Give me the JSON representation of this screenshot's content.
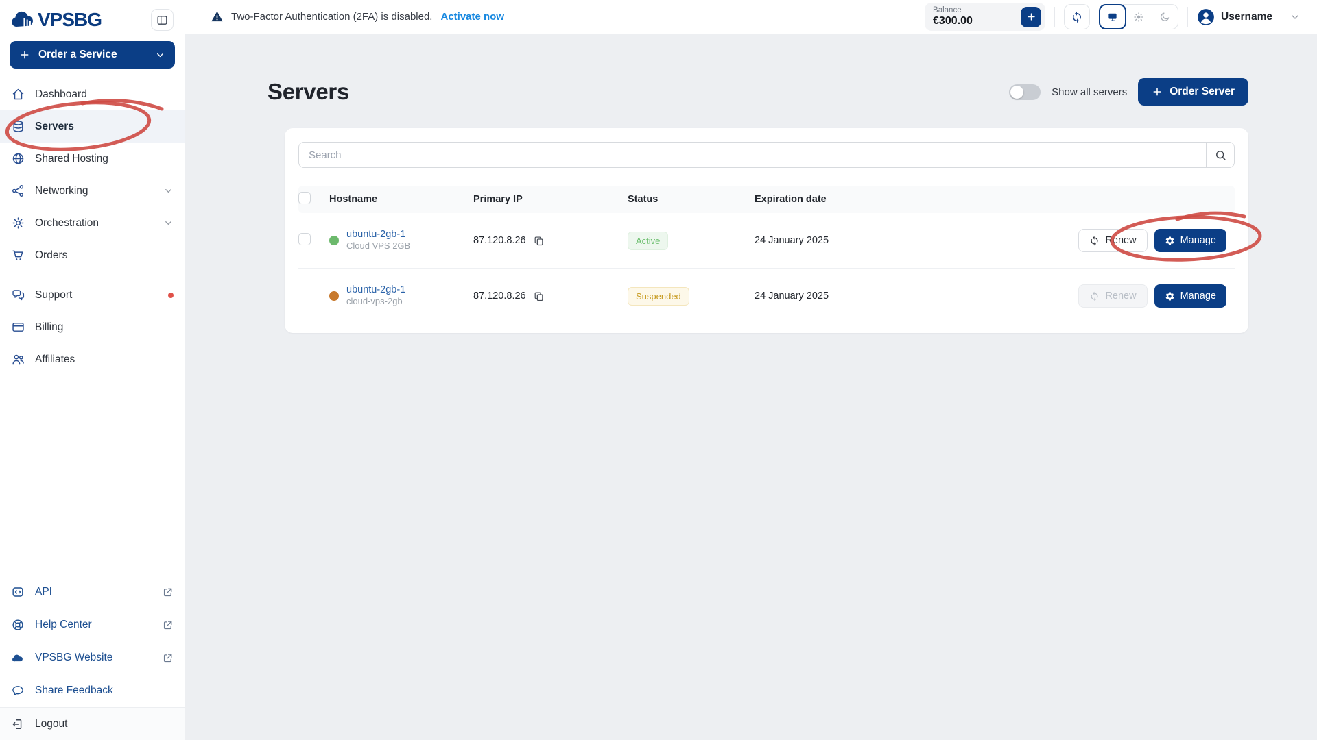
{
  "brand": {
    "name": "VPSBG"
  },
  "colors": {
    "navy": "#0b3e86",
    "link_blue": "#1788e0",
    "hostname_blue": "#2a62a8",
    "annotation_red": "#ce4a44",
    "active_green": "#6cbf6e",
    "suspended_yellow": "#c79a1e",
    "dot_green": "#6cb96c",
    "dot_orange": "#c87a2e",
    "page_background": "#edeff2"
  },
  "icons": {
    "vpsbg-logo-icon": "navy cloud with bars",
    "collapse-sidebar-icon": "panel outline",
    "plus-icon": "+",
    "chevron-down-icon": "v",
    "home-icon": "house outline",
    "servers-icon": "stacked discs",
    "globe-icon": "globe outline",
    "network-icon": "share nodes",
    "orchestration-icon": "cog",
    "cart-icon": "shopping cart",
    "chat-icon": "speech bubbles",
    "billing-icon": "card",
    "affiliates-icon": "two people",
    "api-icon": "code brackets box",
    "help-icon": "lifebuoy",
    "cloud-icon": "cloud",
    "feedback-icon": "speech bubble",
    "logout-icon": "door arrow",
    "external-link-icon": "box arrow",
    "warning-icon": "filled triangle !",
    "refresh-icon": "sync arrows",
    "monitor-icon": "screen",
    "sun-icon": "sun",
    "moon-icon": "crescent",
    "avatar-icon": "person in circle",
    "search-icon": "magnifier",
    "copy-icon": "two sheets",
    "gear-icon": "cog"
  },
  "sidebar": {
    "order_button": "Order a Service",
    "items": [
      {
        "label": "Dashboard"
      },
      {
        "label": "Servers",
        "active": true,
        "annotated": true
      },
      {
        "label": "Shared Hosting"
      },
      {
        "label": "Networking",
        "chevron": true
      },
      {
        "label": "Orchestration",
        "chevron": true
      },
      {
        "label": "Orders"
      },
      {
        "label": "Support",
        "notification_dot": true
      },
      {
        "label": "Billing"
      },
      {
        "label": "Affiliates"
      }
    ],
    "footer_items": [
      {
        "label": "API",
        "external": true
      },
      {
        "label": "Help Center",
        "external": true
      },
      {
        "label": "VPSBG Website",
        "external": true
      },
      {
        "label": "Share Feedback",
        "external": false
      }
    ],
    "logout_label": "Logout"
  },
  "topbar": {
    "warning_text": "Two-Factor Authentication (2FA) is disabled.",
    "warning_link": "Activate now",
    "balance_label": "Balance",
    "balance_value": "€300.00",
    "theme": {
      "selected": "system"
    },
    "username": "Username"
  },
  "main": {
    "title": "Servers",
    "show_all": {
      "label": "Show all servers",
      "enabled": false
    },
    "order_server_button": "Order Server",
    "search_placeholder": "Search",
    "table": {
      "headers": [
        "Hostname",
        "Primary IP",
        "Status",
        "Expiration date"
      ],
      "rows": [
        {
          "hostname": "ubuntu-2gb-1",
          "plan": "Cloud VPS 2GB",
          "ip": "87.120.8.26",
          "status": "Active",
          "expiration": "24 January 2025",
          "renew_label": "Renew",
          "manage_label": "Manage",
          "has_checkbox": true,
          "renew_disabled": false,
          "manage_annotated": true
        },
        {
          "hostname": "ubuntu-2gb-1",
          "plan": "cloud-vps-2gb",
          "ip": "87.120.8.26",
          "status": "Suspended",
          "expiration": "24 January 2025",
          "renew_label": "Renew",
          "manage_label": "Manage",
          "has_checkbox": false,
          "renew_disabled": true,
          "manage_annotated": false
        }
      ]
    }
  }
}
